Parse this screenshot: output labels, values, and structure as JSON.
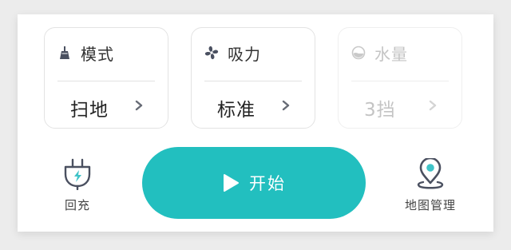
{
  "settings": {
    "mode": {
      "title": "模式",
      "value": "扫地",
      "icon": "broom-icon"
    },
    "suction": {
      "title": "吸力",
      "value": "标准",
      "icon": "fan-icon"
    },
    "water": {
      "title": "水量",
      "value": "3挡",
      "icon": "water-level-icon",
      "disabled": true
    }
  },
  "dock": {
    "recharge_label": "回充",
    "start_label": "开始",
    "map_label": "地图管理"
  },
  "colors": {
    "accent": "#22bfbf",
    "icon": "#4a5060",
    "disabled": "#c4c4c4",
    "map_pin_inner": "#3fc3c8"
  }
}
